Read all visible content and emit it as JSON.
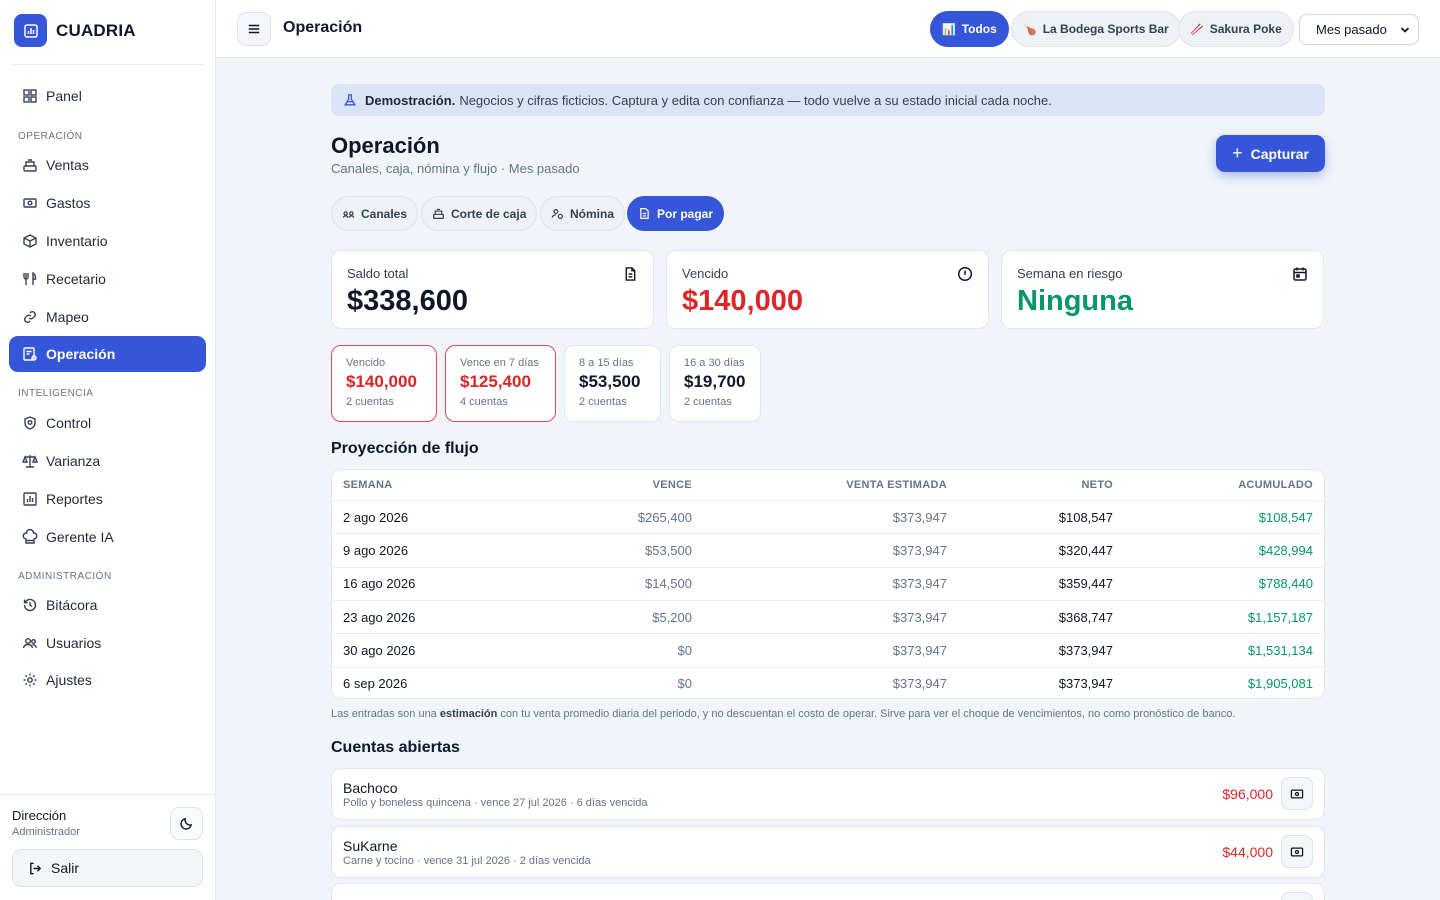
{
  "app": {
    "name": "CUADRIA"
  },
  "sidebar": {
    "sections": [
      "OPERACIÓN",
      "INTELIGENCIA",
      "ADMINISTRACIÓN"
    ],
    "items": [
      {
        "label": "Panel",
        "icon": "grid-icon"
      },
      {
        "label": "Ventas",
        "icon": "cash-register-icon"
      },
      {
        "label": "Gastos",
        "icon": "money-icon"
      },
      {
        "label": "Inventario",
        "icon": "box-icon"
      },
      {
        "label": "Recetario",
        "icon": "utensils-icon"
      },
      {
        "label": "Mapeo",
        "icon": "link-icon"
      },
      {
        "label": "Operación",
        "icon": "receipt-cog-icon",
        "active": true
      },
      {
        "label": "Control",
        "icon": "shield-icon"
      },
      {
        "label": "Varianza",
        "icon": "scale-icon"
      },
      {
        "label": "Reportes",
        "icon": "report-chart-icon"
      },
      {
        "label": "Gerente IA",
        "icon": "chef-hat-icon"
      },
      {
        "label": "Bitácora",
        "icon": "history-icon"
      },
      {
        "label": "Usuarios",
        "icon": "users-icon"
      },
      {
        "label": "Ajustes",
        "icon": "gear-icon"
      }
    ],
    "user": {
      "name": "Dirección",
      "role": "Administrador"
    },
    "logout_label": "Salir"
  },
  "topbar": {
    "title": "Operación",
    "business_filters": [
      {
        "label": "Todos",
        "emoji": "📊",
        "active": true
      },
      {
        "label": "La Bodega Sports Bar",
        "emoji": "🍗"
      },
      {
        "label": "Sakura Poke",
        "emoji": "🥢"
      }
    ],
    "period": "Mes pasado"
  },
  "banner": {
    "strong": "Demostración.",
    "text": "Negocios y cifras ficticios. Captura y edita con confianza — todo vuelve a su estado inicial cada noche."
  },
  "page": {
    "title": "Operación",
    "subtitle": "Canales, caja, nómina y flujo · Mes pasado",
    "capture_label": "Capturar",
    "tabs": [
      {
        "label": "Canales",
        "icon": "channels-icon"
      },
      {
        "label": "Corte de caja",
        "icon": "cash-register-icon"
      },
      {
        "label": "Nómina",
        "icon": "payroll-icon"
      },
      {
        "label": "Por pagar",
        "icon": "invoice-icon",
        "active": true
      }
    ]
  },
  "kpis": [
    {
      "label": "Saldo total",
      "value": "$338,600",
      "icon": "document-icon",
      "color": "#0f172a"
    },
    {
      "label": "Vencido",
      "value": "$140,000",
      "icon": "alert-circle-icon",
      "color": "#dc2626"
    },
    {
      "label": "Semana en riesgo",
      "value": "Ninguna",
      "icon": "calendar-icon",
      "color": "#059669"
    }
  ],
  "buckets": [
    {
      "label": "Vencido",
      "amount": "$140,000",
      "count": "2 cuentas",
      "alert": true
    },
    {
      "label": "Vence en 7 días",
      "amount": "$125,400",
      "count": "4 cuentas",
      "alert": true
    },
    {
      "label": "8 a 15 días",
      "amount": "$53,500",
      "count": "2 cuentas",
      "alert": false
    },
    {
      "label": "16 a 30 días",
      "amount": "$19,700",
      "count": "2 cuentas",
      "alert": false
    }
  ],
  "projection": {
    "title": "Proyección de flujo",
    "columns": [
      "SEMANA",
      "VENCE",
      "VENTA ESTIMADA",
      "NETO",
      "ACUMULADO"
    ],
    "rows": [
      [
        "2 ago 2026",
        "$265,400",
        "$373,947",
        "$108,547",
        "$108,547"
      ],
      [
        "9 ago 2026",
        "$53,500",
        "$373,947",
        "$320,447",
        "$428,994"
      ],
      [
        "16 ago 2026",
        "$14,500",
        "$373,947",
        "$359,447",
        "$788,440"
      ],
      [
        "23 ago 2026",
        "$5,200",
        "$373,947",
        "$368,747",
        "$1,157,187"
      ],
      [
        "30 ago 2026",
        "$0",
        "$373,947",
        "$373,947",
        "$1,531,134"
      ],
      [
        "6 sep 2026",
        "$0",
        "$373,947",
        "$373,947",
        "$1,905,081"
      ]
    ],
    "note_pre": "Las entradas son una",
    "note_strong": "estimación",
    "note_post": "con tu venta promedio diaria del periodo, y no descuentan el costo de operar. Sirve para ver el choque de vencimientos, no como pronóstico de banco."
  },
  "accounts": {
    "title": "Cuentas abiertas",
    "items": [
      {
        "name": "Bachoco",
        "detail": "Pollo y boneless quincena · vence 27 jul 2026 · 6 días vencida",
        "amount": "$96,000"
      },
      {
        "name": "SuKarne",
        "detail": "Carne y tocino · vence 31 jul 2026 · 2 días vencida",
        "amount": "$44,000"
      },
      {
        "name": "",
        "detail": "",
        "amount": ""
      }
    ]
  },
  "colors": {
    "accent": "#3656d9",
    "danger": "#dc2626",
    "success": "#059669"
  }
}
